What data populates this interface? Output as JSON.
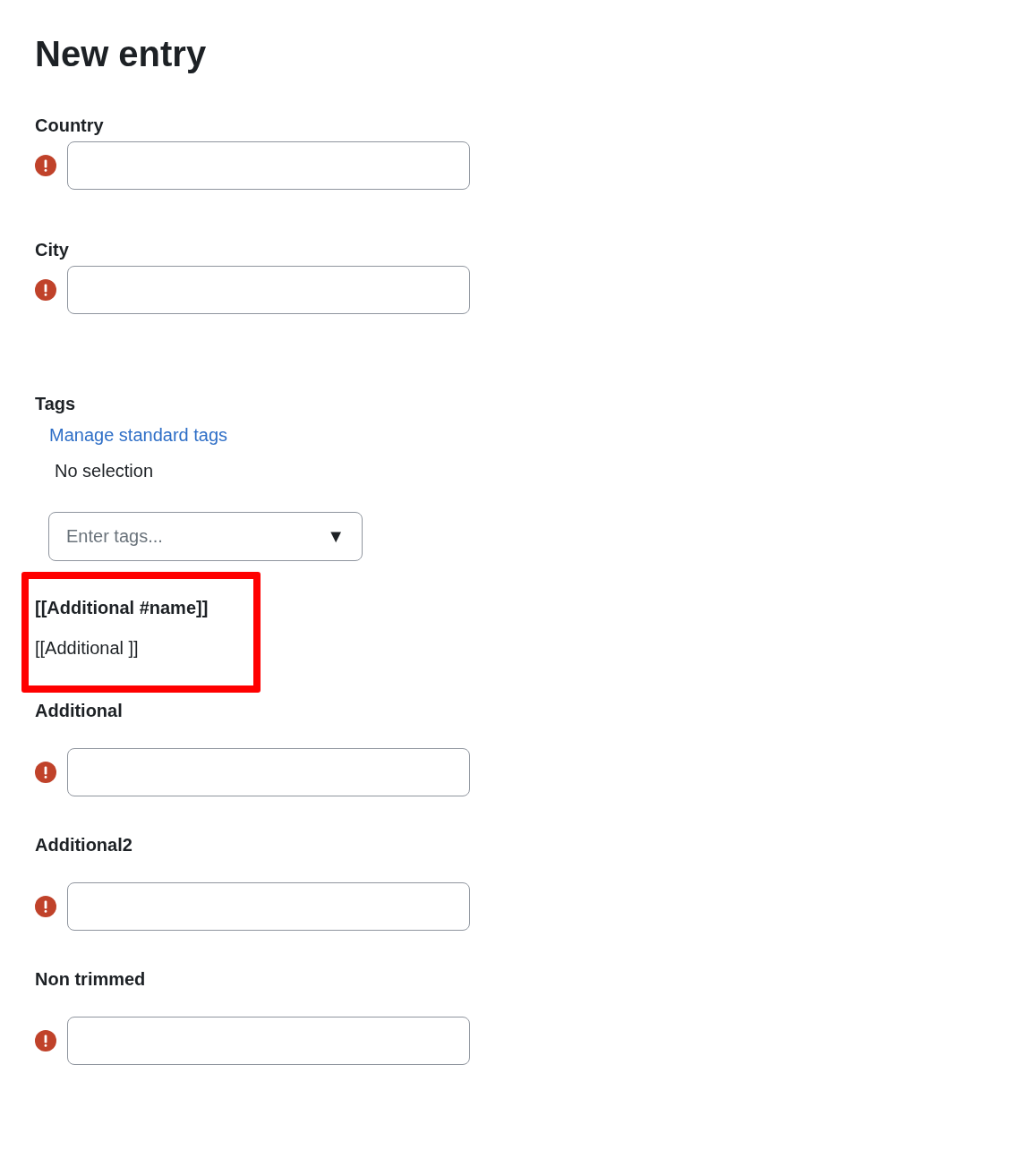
{
  "title": "New entry",
  "fields_top": [
    {
      "label": "Country",
      "required": true
    },
    {
      "label": "City",
      "required": true
    }
  ],
  "tags": {
    "label": "Tags",
    "link": "Manage standard tags",
    "selection": "No selection",
    "placeholder": "Enter tags...",
    "caret": "▼"
  },
  "template": {
    "highlighted": true,
    "heading": "[[Additional #name]]",
    "text": "[[Additional ]]"
  },
  "fields_bottom": [
    {
      "label": "Additional",
      "required": true
    },
    {
      "label": "Additional2",
      "required": true
    },
    {
      "label": "Non trimmed",
      "required": true
    }
  ]
}
